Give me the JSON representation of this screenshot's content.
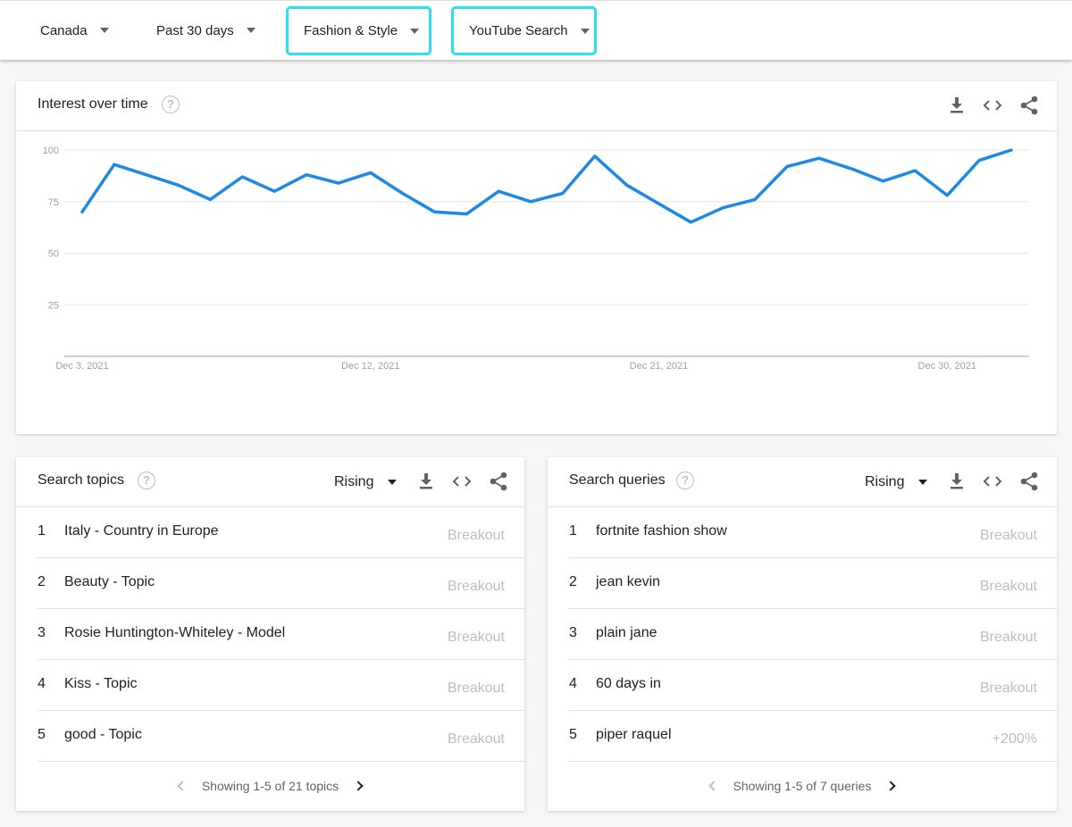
{
  "filters": {
    "region": "Canada",
    "time_range": "Past 30 days",
    "category": "Fashion & Style",
    "property": "YouTube Search"
  },
  "interest_over_time": {
    "title": "Interest over time",
    "help_icon": "help-circle-icon",
    "actions": [
      "download-icon",
      "embed-code-icon",
      "share-icon"
    ]
  },
  "chart_data": {
    "type": "line",
    "title": "",
    "xlabel": "",
    "ylabel": "",
    "ylim": [
      0,
      100
    ],
    "y_ticks": [
      "25",
      "50",
      "75",
      "100"
    ],
    "x_tick_labels": [
      "Dec 3, 2021",
      "Dec 12, 2021",
      "Dec 21, 2021",
      "Dec 30, 2021"
    ],
    "x": [
      "2021-12-03",
      "2021-12-04",
      "2021-12-05",
      "2021-12-06",
      "2021-12-07",
      "2021-12-08",
      "2021-12-09",
      "2021-12-10",
      "2021-12-11",
      "2021-12-12",
      "2021-12-13",
      "2021-12-14",
      "2021-12-15",
      "2021-12-16",
      "2021-12-17",
      "2021-12-18",
      "2021-12-19",
      "2021-12-20",
      "2021-12-21",
      "2021-12-22",
      "2021-12-23",
      "2021-12-24",
      "2021-12-25",
      "2021-12-26",
      "2021-12-27",
      "2021-12-28",
      "2021-12-29",
      "2021-12-30",
      "2021-12-31",
      "2022-01-01"
    ],
    "series": [
      {
        "values": [
          70,
          93,
          88,
          83,
          76,
          87,
          80,
          88,
          84,
          89,
          79,
          70,
          69,
          80,
          75,
          79,
          97,
          83,
          74,
          65,
          72,
          76,
          92,
          96,
          91,
          85,
          90,
          78,
          95,
          100
        ]
      }
    ],
    "grid": true,
    "line_color": "#1e88e5"
  },
  "search_topics": {
    "title": "Search topics",
    "filter": "Rising",
    "items": [
      {
        "rank": "1",
        "label": "Italy - Country in Europe",
        "value": "Breakout"
      },
      {
        "rank": "2",
        "label": "Beauty - Topic",
        "value": "Breakout"
      },
      {
        "rank": "3",
        "label": "Rosie Huntington-Whiteley - Model",
        "value": "Breakout"
      },
      {
        "rank": "4",
        "label": "Kiss - Topic",
        "value": "Breakout"
      },
      {
        "rank": "5",
        "label": "good - Topic",
        "value": "Breakout"
      }
    ],
    "pager": "Showing 1-5 of 21 topics"
  },
  "search_queries": {
    "title": "Search queries",
    "filter": "Rising",
    "items": [
      {
        "rank": "1",
        "label": "fortnite fashion show",
        "value": "Breakout"
      },
      {
        "rank": "2",
        "label": "jean kevin",
        "value": "Breakout"
      },
      {
        "rank": "3",
        "label": "plain jane",
        "value": "Breakout"
      },
      {
        "rank": "4",
        "label": "60 days in",
        "value": "Breakout"
      },
      {
        "rank": "5",
        "label": "piper raquel",
        "value": "+200%"
      }
    ],
    "pager": "Showing 1-5 of 7 queries"
  }
}
